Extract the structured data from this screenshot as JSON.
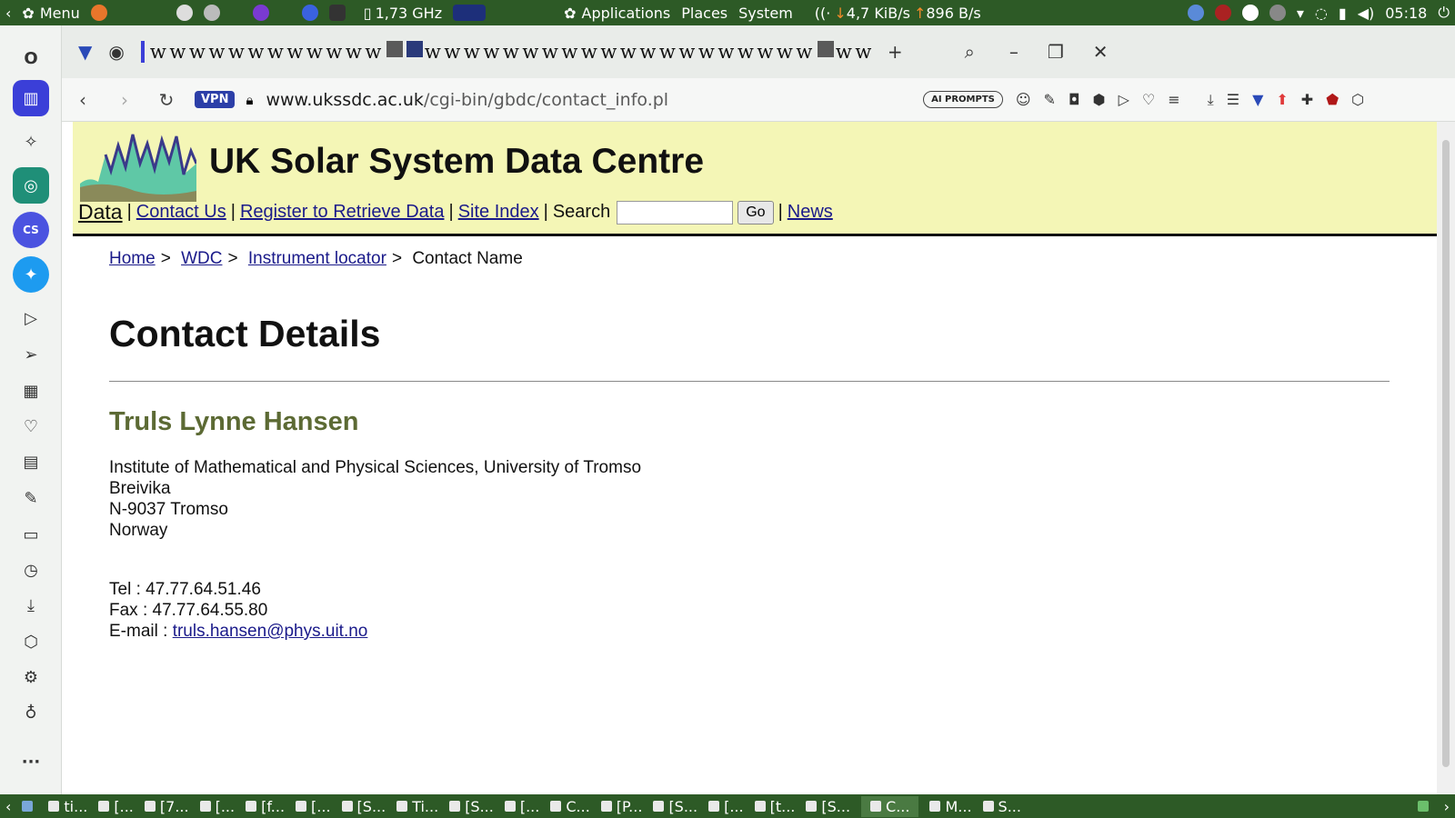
{
  "top_panel": {
    "menu_label": "Menu",
    "cpu_freq": "1,73 GHz",
    "applications": "Applications",
    "places": "Places",
    "system": "System",
    "download_speed": "4,7 KiB/s",
    "upload_speed": "896 B/s",
    "clock": "05:18"
  },
  "browser": {
    "tab_glyph": "w",
    "vpn_label": "VPN",
    "url_host": "www.ukssdc.ac.uk",
    "url_path": "/cgi-bin/gbdc/contact_info.pl",
    "ai_prompts_label": "AI PROMPTS"
  },
  "site": {
    "title": "UK Solar System Data Centre",
    "nav": {
      "data": "Data",
      "contact": "Contact Us",
      "register": "Register to Retrieve Data",
      "site_index": "Site Index",
      "search_label": "Search",
      "go": "Go",
      "news": "News"
    }
  },
  "breadcrumb": {
    "home": "Home",
    "wdc": "WDC",
    "instrument_locator": "Instrument locator",
    "current": "Contact Name"
  },
  "page": {
    "title": "Contact Details",
    "contact_name": "Truls Lynne Hansen",
    "address_lines": [
      "Institute of Mathematical and Physical Sciences, University of Tromso",
      "Breivika",
      "N-9037 Tromso",
      "Norway"
    ],
    "tel": "Tel : 47.77.64.51.46",
    "fax": "Fax : 47.77.64.55.80",
    "email_label": "E-mail : ",
    "email": "truls.hansen@phys.uit.no"
  },
  "taskbar": {
    "items": [
      "ti...",
      "[...",
      "[7...",
      "[...",
      "[f...",
      "[...",
      "[S...",
      "Ti...",
      "[S...",
      "[...",
      "C...",
      "[P...",
      "[S...",
      "[...",
      "[t...",
      "[S...",
      "C...",
      "M...",
      "S..."
    ]
  }
}
